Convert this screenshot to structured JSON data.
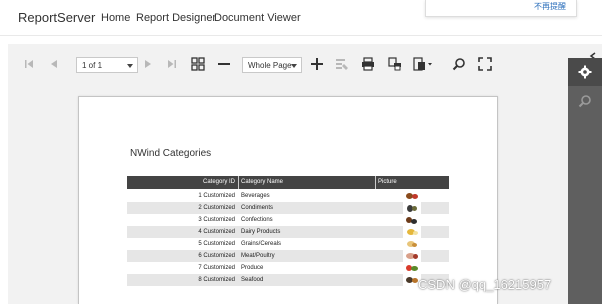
{
  "navbar": {
    "brand": "ReportServer",
    "links": [
      "Home",
      "Report Designer",
      "Document Viewer"
    ]
  },
  "toast": {
    "link_text": "不再提醒"
  },
  "toolbar": {
    "page_select": "1 of 1",
    "zoom_select": "Whole Page",
    "icons": [
      "first-page-icon",
      "previous-page-icon",
      "next-page-icon",
      "last-page-icon",
      "multipage-icon",
      "zoom-out-icon",
      "zoom-in-icon",
      "highlight-editing-fields-icon",
      "print-icon",
      "print-page-icon",
      "export-icon",
      "search-icon",
      "fullscreen-icon"
    ]
  },
  "side_panel": {
    "icons": [
      "collapse-chevron-icon",
      "gear-icon",
      "search-icon"
    ]
  },
  "report": {
    "title": "NWind Categories",
    "columns": [
      "Category ID",
      "Category Name",
      "Picture"
    ],
    "rows": [
      {
        "id": "1 Customized",
        "name": "Beverages"
      },
      {
        "id": "2 Customized",
        "name": "Condiments"
      },
      {
        "id": "3 Customized",
        "name": "Confections"
      },
      {
        "id": "4 Customized",
        "name": "Dairy Products"
      },
      {
        "id": "5 Customized",
        "name": "Grains/Cereals"
      },
      {
        "id": "6 Customized",
        "name": "Meat/Poultry"
      },
      {
        "id": "7 Customized",
        "name": "Produce"
      },
      {
        "id": "8 Customized",
        "name": "Seafood"
      }
    ]
  },
  "watermark": "CSDN @qq_16215957",
  "colors": {
    "side_panel": "#5f5f5f",
    "table_header": "#444444",
    "row_alt": "#e6e6e6",
    "link": "#2a6ebb"
  }
}
